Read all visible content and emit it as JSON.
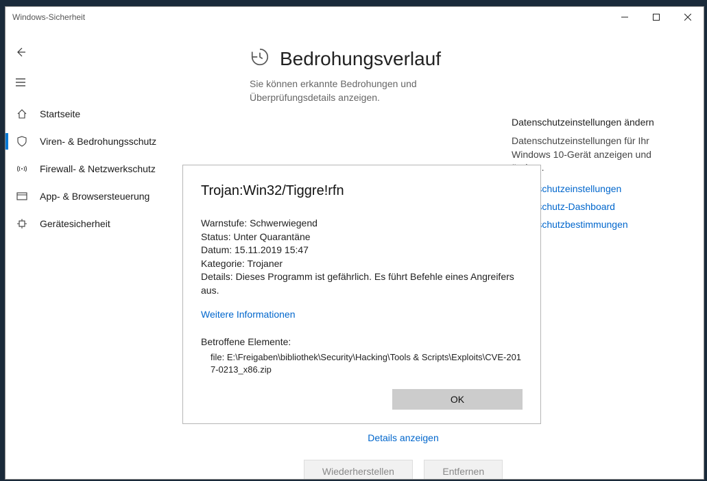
{
  "window": {
    "title": "Windows-Sicherheit"
  },
  "sidebar": {
    "items": [
      {
        "label": "Startseite"
      },
      {
        "label": "Viren- & Bedrohungsschutz"
      },
      {
        "label": "Firewall- & Netzwerkschutz"
      },
      {
        "label": "App- & Browsersteuerung"
      },
      {
        "label": "Gerätesicherheit"
      }
    ]
  },
  "page": {
    "title": "Bedrohungsverlauf",
    "subtitle": "Sie können erkannte Bedrohungen und Überprüfungsdetails anzeigen."
  },
  "right": {
    "title": "Datenschutzeinstellungen ändern",
    "text": "Datenschutzeinstellungen für Ihr Windows 10-Gerät anzeigen und ändern.",
    "link1": "Datenschutzeinstellungen",
    "link2": "Datenschutz-Dashboard",
    "link3": "Datenschutzbestimmungen"
  },
  "bottom": {
    "details_link": "Details anzeigen",
    "restore": "Wiederherstellen",
    "remove": "Entfernen"
  },
  "dialog": {
    "threat_name": "Trojan:Win32/Tiggre!rfn",
    "fields": {
      "warn_label": "Warnstufe:",
      "warn_value": "Schwerwiegend",
      "status_label": "Status:",
      "status_value": "Unter Quarantäne",
      "date_label": "Datum:",
      "date_value": "15.11.2019 15:47",
      "cat_label": "Kategorie:",
      "cat_value": "Trojaner",
      "details_label": "Details:",
      "details_value": "Dieses Programm ist gefährlich. Es führt Befehle eines Angreifers aus."
    },
    "more_info": "Weitere Informationen",
    "affected_title": "Betroffene Elemente:",
    "affected_path": "file: E:\\Freigaben\\bibliothek\\Security\\Hacking\\Tools & Scripts\\Exploits\\CVE-2017-0213_x86.zip",
    "ok": "OK"
  }
}
